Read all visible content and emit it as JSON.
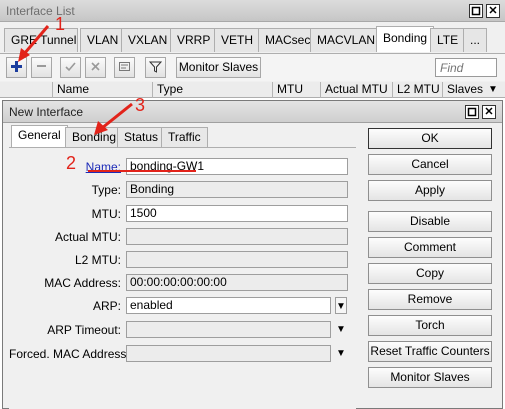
{
  "outer_window": {
    "title": "Interface List",
    "restore_icon": "restore-icon",
    "close_label": "✕",
    "tabs": [
      {
        "label": "GRE Tunnel"
      },
      {
        "label": "VLAN"
      },
      {
        "label": "VXLAN"
      },
      {
        "label": "VRRP"
      },
      {
        "label": "VETH"
      },
      {
        "label": "MACsec"
      },
      {
        "label": "MACVLAN"
      },
      {
        "label": "Bonding"
      },
      {
        "label": "LTE"
      },
      {
        "label": "..."
      }
    ],
    "active_tab": "Bonding",
    "toolbar": {
      "add_icon": "plus-icon",
      "remove_icon": "minus-icon",
      "enable_icon": "check-icon",
      "disable_icon": "x-icon",
      "comment_icon": "note-icon",
      "filter_icon": "filter-icon",
      "monitor_slaves_label": "Monitor Slaves",
      "find_placeholder": "Find"
    },
    "columns": [
      "Name",
      "Type",
      "MTU",
      "Actual MTU",
      "L2 MTU",
      "Slaves"
    ]
  },
  "dialog": {
    "title": "New Interface",
    "tabs": [
      "General",
      "Bonding",
      "Status",
      "Traffic"
    ],
    "active_tab": "General",
    "fields": {
      "name": {
        "label": "Name:",
        "value": "bonding-GW1"
      },
      "type": {
        "label": "Type:",
        "value": "Bonding"
      },
      "mtu": {
        "label": "MTU:",
        "value": "1500"
      },
      "actual_mtu": {
        "label": "Actual MTU:",
        "value": ""
      },
      "l2_mtu": {
        "label": "L2 MTU:",
        "value": ""
      },
      "mac_address": {
        "label": "MAC Address:",
        "value": "00:00:00:00:00:00"
      },
      "arp": {
        "label": "ARP:",
        "value": "enabled"
      },
      "arp_timeout": {
        "label": "ARP Timeout:",
        "value": ""
      },
      "forced_mac": {
        "label": "Forced. MAC Address:",
        "value": ""
      }
    },
    "buttons": [
      "OK",
      "Cancel",
      "Apply",
      "Disable",
      "Comment",
      "Copy",
      "Remove",
      "Torch",
      "Reset Traffic Counters",
      "Monitor Slaves"
    ]
  },
  "annotations": {
    "step1": "1",
    "step2": "2",
    "step3": "3",
    "color": "#e2231a"
  }
}
